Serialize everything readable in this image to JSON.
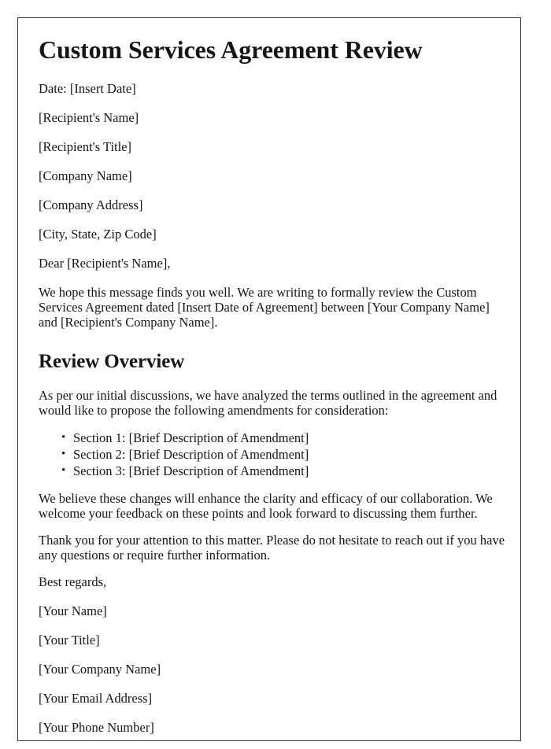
{
  "document": {
    "title": "Custom Services Agreement Review",
    "date_line": "Date: [Insert Date]",
    "recipient_block": [
      "[Recipient's Name]",
      "[Recipient's Title]",
      "[Company Name]",
      "[Company Address]",
      "[City, State, Zip Code]"
    ],
    "salutation": "Dear [Recipient's Name],",
    "intro_paragraph": "We hope this message finds you well. We are writing to formally review the Custom Services Agreement dated [Insert Date of Agreement] between [Your Company Name] and [Recipient's Company Name].",
    "review_section": {
      "heading": "Review Overview",
      "lead_paragraph": "As per our initial discussions, we have analyzed the terms outlined in the agreement and would like to propose the following amendments for consideration:",
      "amendments": [
        "Section 1: [Brief Description of Amendment]",
        "Section 2: [Brief Description of Amendment]",
        "Section 3: [Brief Description of Amendment]"
      ],
      "closing_paragraph": "We believe these changes will enhance the clarity and efficacy of our collaboration. We welcome your feedback on these points and look forward to discussing them further."
    },
    "thanks_paragraph": "Thank you for your attention to this matter. Please do not hesitate to reach out if you have any questions or require further information.",
    "signoff": "Best regards,",
    "signature_block": [
      "[Your Name]",
      "[Your Title]",
      "[Your Company Name]",
      "[Your Email Address]",
      "[Your Phone Number]"
    ]
  },
  "style": {
    "text_color": "#161616",
    "page_background": "#ffffff",
    "page_border_color": "#3a3a3a"
  }
}
